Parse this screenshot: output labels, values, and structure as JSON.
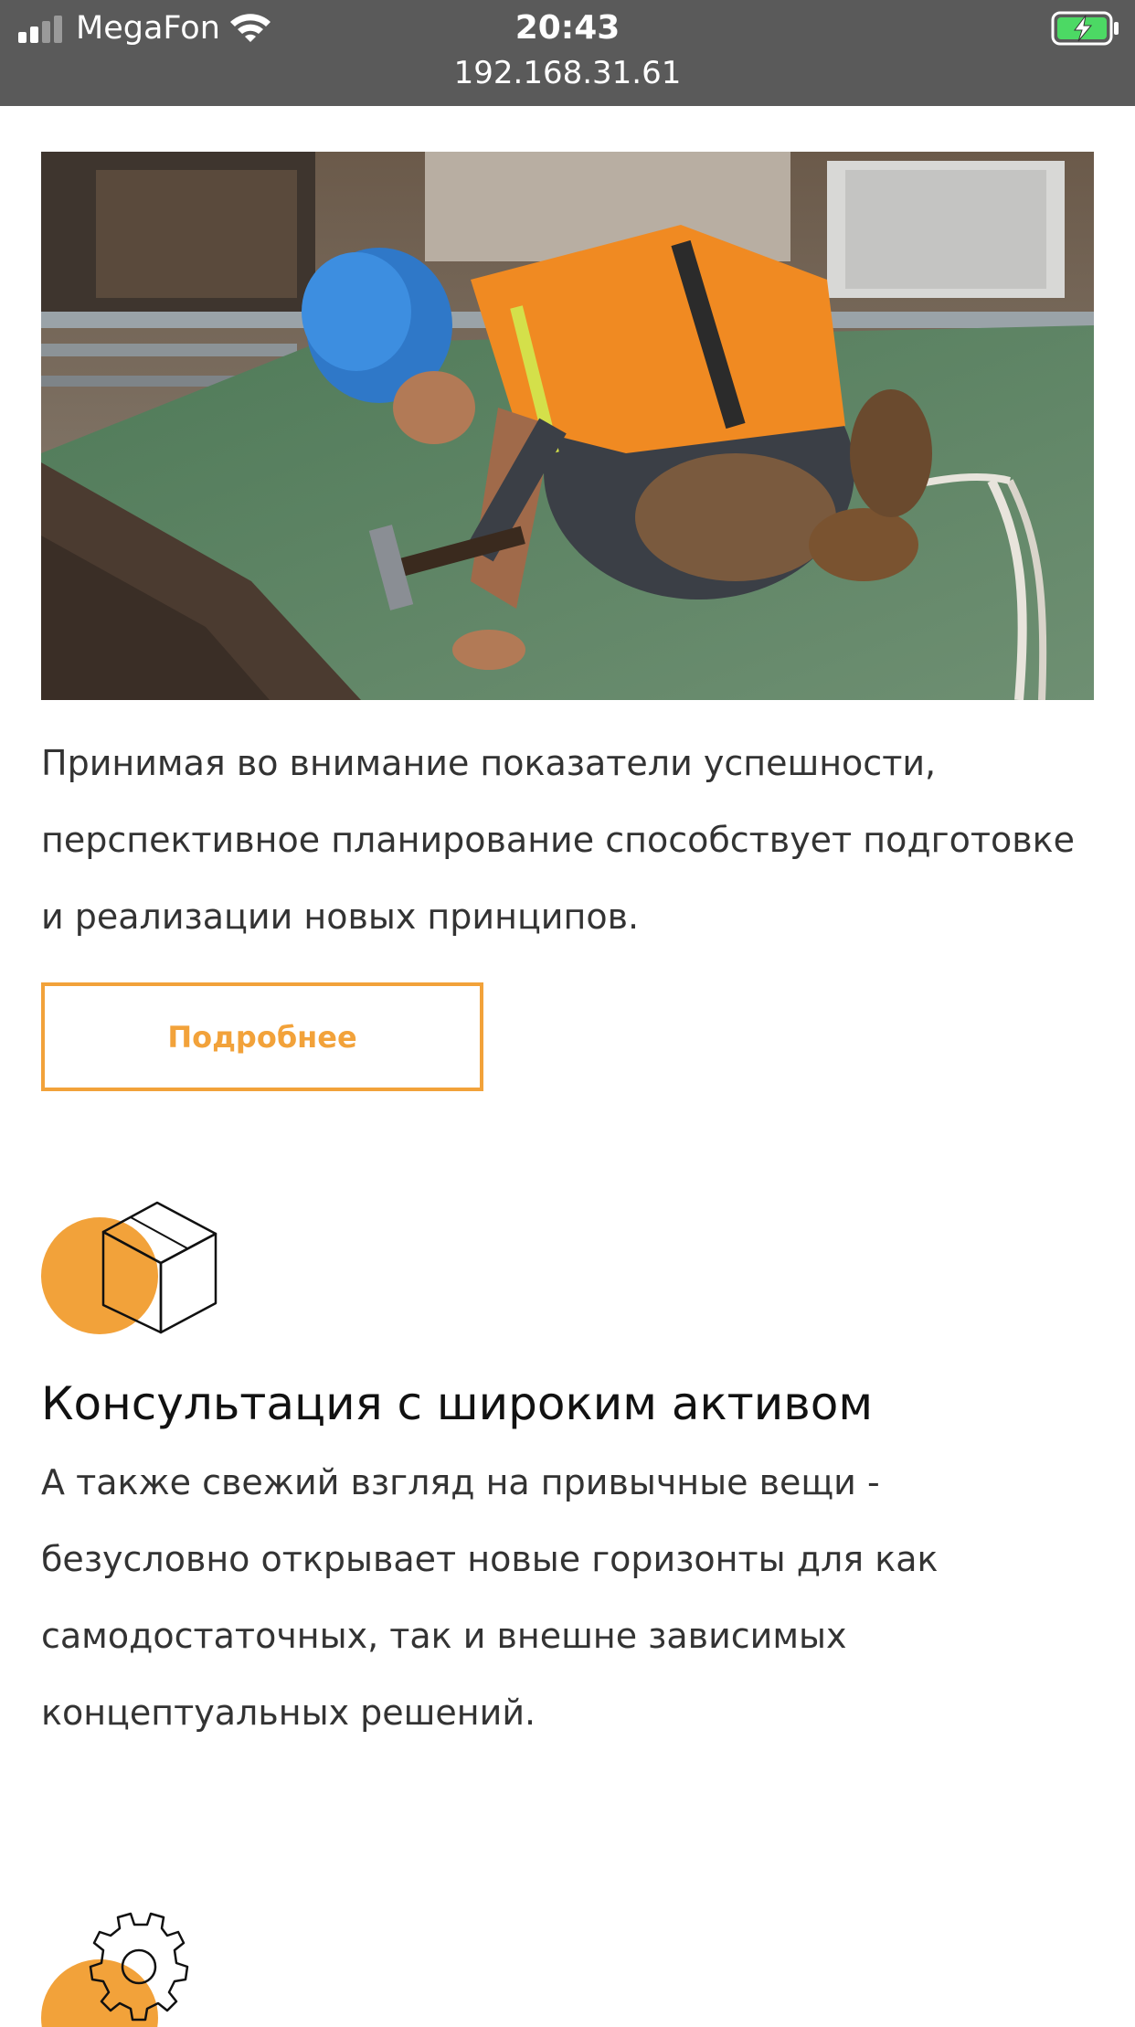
{
  "status_bar": {
    "carrier": "MegaFon",
    "time": "20:43",
    "url": "192.168.31.61",
    "battery_state": "charging",
    "battery_color": "#4cd964"
  },
  "hero": {
    "image": "construction-worker-hammer-photo"
  },
  "intro": {
    "text": "Принимая во внимание показатели успешности, перспективное планирование способствует подготовке и реализации новых принципов.",
    "button_label": "Подробнее"
  },
  "features": [
    {
      "icon": "box-icon",
      "title": "Консультация с широким активом",
      "text": "А также свежий взгляд на привычные вещи - безусловно открывает новые горизонты для как самодостаточных, так и внешне зависимых концептуальных решений."
    },
    {
      "icon": "gear-icon"
    }
  ],
  "colors": {
    "accent": "#f2a23a",
    "status_bar_bg": "#5a5a5a",
    "text": "#333333"
  }
}
